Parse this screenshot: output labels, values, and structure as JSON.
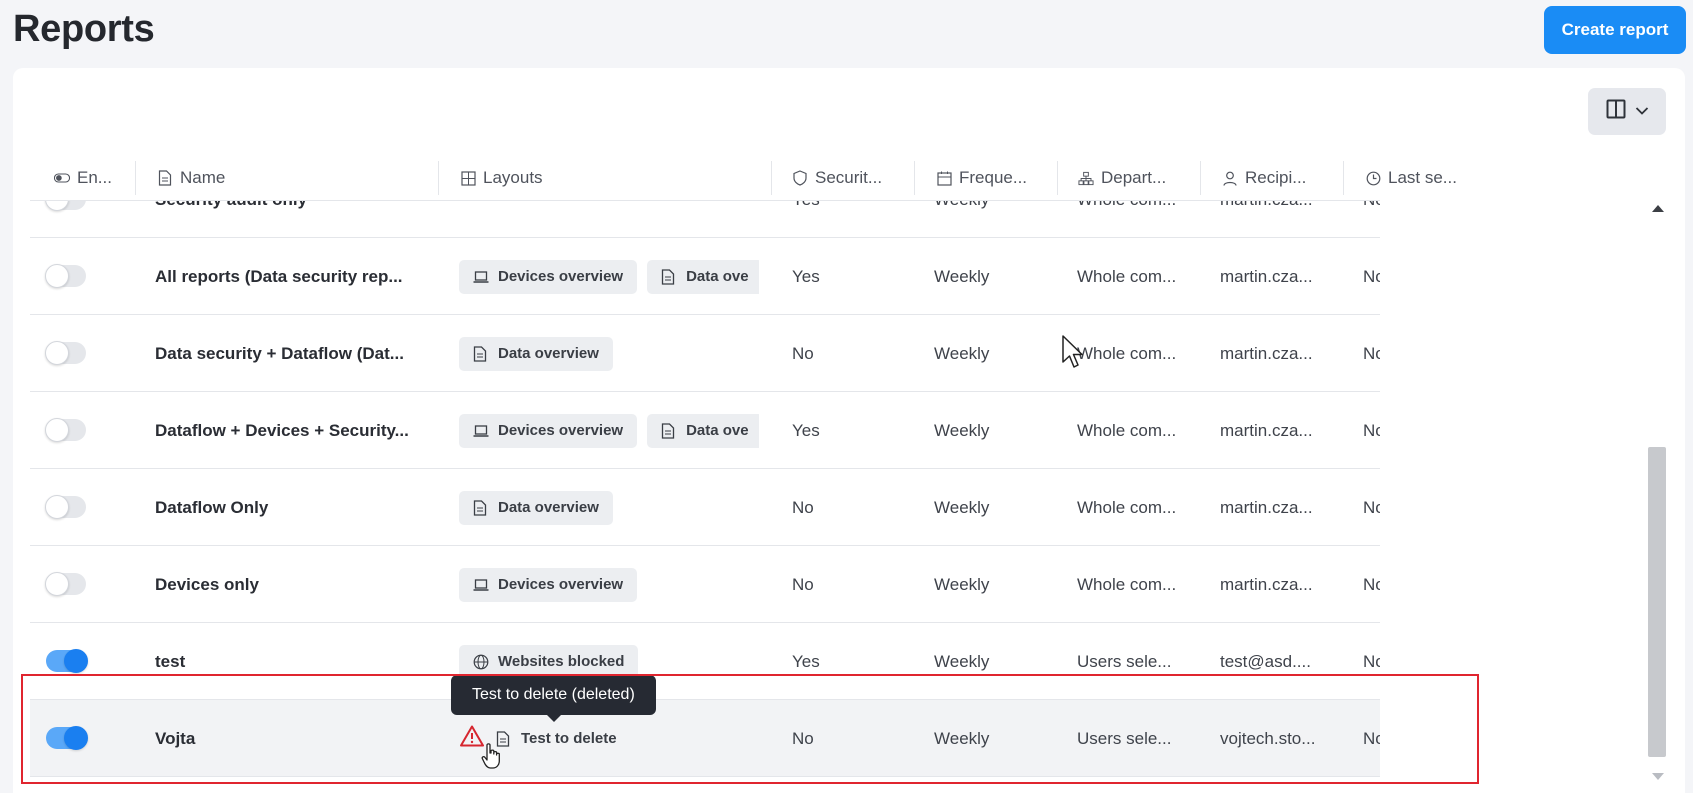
{
  "page": {
    "title": "Reports",
    "create_button": "Create report"
  },
  "table": {
    "columns": [
      {
        "key": "enabled",
        "label": "En...",
        "icon": "toggle-icon"
      },
      {
        "key": "name",
        "label": "Name",
        "icon": "document-icon"
      },
      {
        "key": "layouts",
        "label": "Layouts",
        "icon": "grid-icon"
      },
      {
        "key": "security",
        "label": "Securit...",
        "icon": "shield-icon"
      },
      {
        "key": "frequency",
        "label": "Freque...",
        "icon": "calendar-icon"
      },
      {
        "key": "department",
        "label": "Depart...",
        "icon": "org-chart-icon"
      },
      {
        "key": "recipients",
        "label": "Recipi...",
        "icon": "user-icon"
      },
      {
        "key": "last_sent",
        "label": "Last se...",
        "icon": "clock-icon"
      }
    ],
    "rows": [
      {
        "enabled": false,
        "name": "Security audit only",
        "layouts": [],
        "security": "Yes",
        "frequency": "Weekly",
        "department": "Whole com...",
        "recipients": "martin.cza...",
        "last_sent": "Not yet"
      },
      {
        "enabled": false,
        "name": "All reports (Data security rep...",
        "layouts": [
          {
            "label": "Devices overview",
            "icon": "laptop-icon"
          },
          {
            "label": "Data ove",
            "icon": "document-icon"
          }
        ],
        "security": "Yes",
        "frequency": "Weekly",
        "department": "Whole com...",
        "recipients": "martin.cza...",
        "last_sent": "Not yet"
      },
      {
        "enabled": false,
        "name": "Data security + Dataflow (Dat...",
        "layouts": [
          {
            "label": "Data overview",
            "icon": "document-icon"
          }
        ],
        "security": "No",
        "frequency": "Weekly",
        "department": "Whole com...",
        "recipients": "martin.cza...",
        "last_sent": "Not yet"
      },
      {
        "enabled": false,
        "name": "Dataflow + Devices + Security...",
        "layouts": [
          {
            "label": "Devices overview",
            "icon": "laptop-icon"
          },
          {
            "label": "Data ove",
            "icon": "document-icon"
          }
        ],
        "security": "Yes",
        "frequency": "Weekly",
        "department": "Whole com...",
        "recipients": "martin.cza...",
        "last_sent": "Not yet"
      },
      {
        "enabled": false,
        "name": "Dataflow Only",
        "layouts": [
          {
            "label": "Data overview",
            "icon": "document-icon"
          }
        ],
        "security": "No",
        "frequency": "Weekly",
        "department": "Whole com...",
        "recipients": "martin.cza...",
        "last_sent": "Not yet"
      },
      {
        "enabled": false,
        "name": "Devices only",
        "layouts": [
          {
            "label": "Devices overview",
            "icon": "laptop-icon"
          }
        ],
        "security": "No",
        "frequency": "Weekly",
        "department": "Whole com...",
        "recipients": "martin.cza...",
        "last_sent": "Not yet"
      },
      {
        "enabled": true,
        "name": "test",
        "layouts": [
          {
            "label": "Websites blocked",
            "icon": "globe-icon"
          }
        ],
        "security": "Yes",
        "frequency": "Weekly",
        "department": "Users sele...",
        "recipients": "test@asd....",
        "last_sent": "Not yet"
      },
      {
        "enabled": true,
        "name": "Vojta",
        "layouts": [
          {
            "label": "Test to delete",
            "icon": "document-icon",
            "warning": true
          }
        ],
        "security": "No",
        "frequency": "Weekly",
        "department": "Users sele...",
        "recipients": "vojtech.sto...",
        "last_sent": "Not yet"
      }
    ]
  },
  "tooltip": {
    "text": "Test to delete (deleted)"
  },
  "colors": {
    "accent": "#1a8cf5",
    "highlight": "#e0252f",
    "warning": "#d6262f"
  }
}
